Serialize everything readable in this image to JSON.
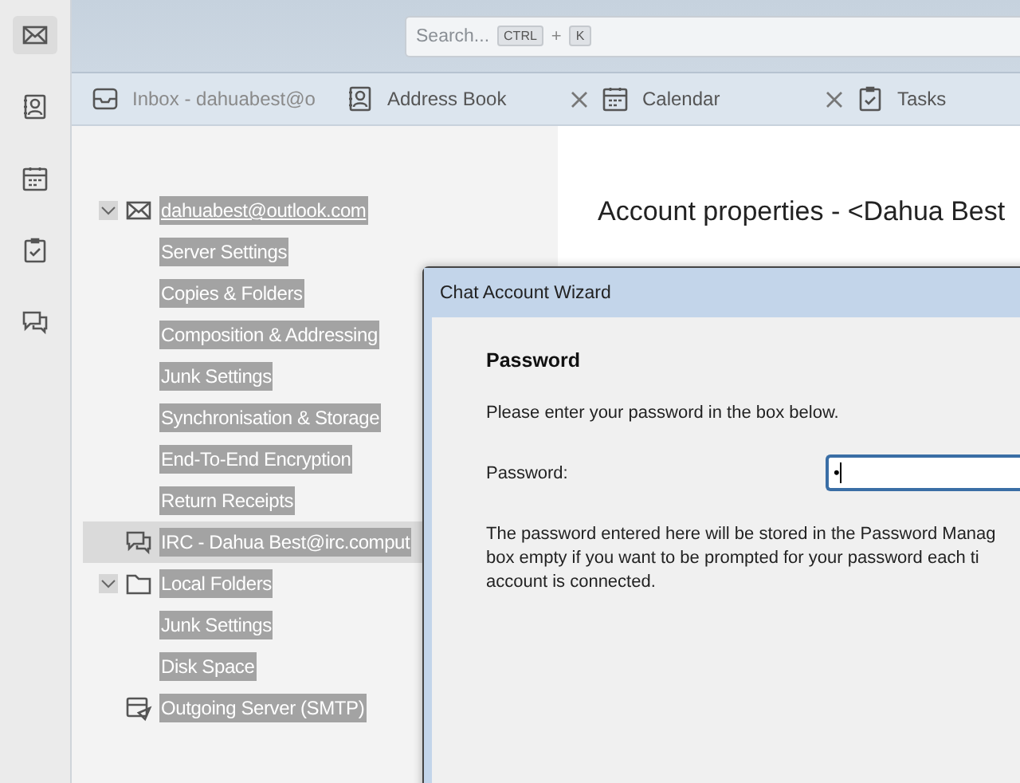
{
  "spaces_toolbar": [
    {
      "kind": "mail",
      "selected": true
    },
    {
      "kind": "contacts",
      "selected": false
    },
    {
      "kind": "calendar",
      "selected": false
    },
    {
      "kind": "tasks",
      "selected": false
    },
    {
      "kind": "chat",
      "selected": false
    }
  ],
  "search": {
    "placeholder": "Search...",
    "shortcut_keys": [
      "CTRL",
      "K"
    ],
    "separator": "+"
  },
  "tabs": [
    {
      "kind": "inbox",
      "label": "Inbox - dahuabest@o",
      "closable": false,
      "selected": false
    },
    {
      "kind": "contacts",
      "label": "Address Book",
      "closable": true,
      "selected": false
    },
    {
      "kind": "calendar",
      "label": "Calendar",
      "closable": true,
      "selected": false
    },
    {
      "kind": "tasks",
      "label": "Tasks",
      "closable": false,
      "selected": false
    }
  ],
  "account_tree": [
    {
      "kind": "mail",
      "label": "dahuabest@outlook.com",
      "expanded": true,
      "selected": false,
      "children": [
        {
          "label": "Server Settings"
        },
        {
          "label": "Copies & Folders"
        },
        {
          "label": "Composition & Addressing"
        },
        {
          "label": "Junk Settings"
        },
        {
          "label": "Synchronisation & Storage"
        },
        {
          "label": "End-To-End Encryption"
        },
        {
          "label": "Return Receipts"
        }
      ]
    },
    {
      "kind": "chat",
      "label": "IRC - Dahua Best@irc.comput",
      "selected": true
    },
    {
      "kind": "folder",
      "label": "Local Folders",
      "expanded": true,
      "selected": false,
      "children": [
        {
          "label": "Junk Settings"
        },
        {
          "label": "Disk Space"
        }
      ]
    },
    {
      "kind": "smtp",
      "label": "Outgoing Server (SMTP)",
      "selected": false
    }
  ],
  "content": {
    "title": "Account properties - <Dahua Best"
  },
  "dialog": {
    "title": "Chat Account Wizard",
    "heading": "Password",
    "intro": "Please enter your password in the box below.",
    "field_label": "Password:",
    "field_value": "•",
    "note_lines": [
      "The password entered here will be stored in the Password Manag",
      "box empty if you want to be prompted for your password each ti",
      "account is connected."
    ]
  }
}
